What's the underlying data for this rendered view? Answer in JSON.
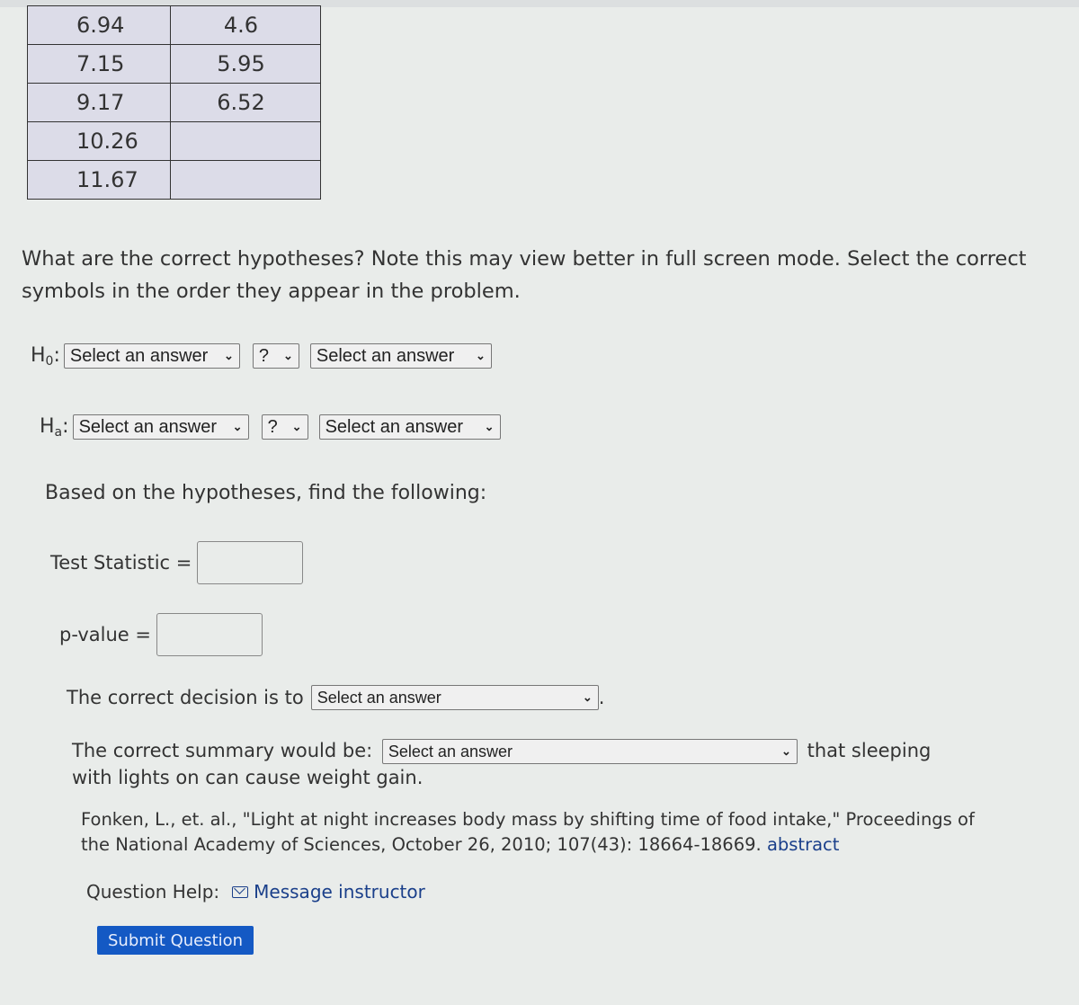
{
  "data_table": {
    "rows": [
      [
        "6.94",
        "4.6"
      ],
      [
        "7.15",
        "5.95"
      ],
      [
        "9.17",
        "6.52"
      ],
      [
        "10.26",
        ""
      ],
      [
        "11.67",
        ""
      ]
    ]
  },
  "question": {
    "text": "What are the correct hypotheses? Note this may view better in full screen mode. Select the correct symbols in the order they appear in the problem."
  },
  "hypotheses": {
    "h0": {
      "label": "H",
      "sub": "0",
      "colon": ":",
      "left": "Select an answer",
      "op": "?",
      "right": "Select an answer"
    },
    "ha": {
      "label": "H",
      "sub": "a",
      "colon": ":",
      "left": "Select an answer",
      "op": "?",
      "right": "Select an answer"
    }
  },
  "based_text": "Based on the hypotheses, find the following:",
  "fields": {
    "test_statistic_label": "Test Statistic =",
    "test_statistic_value": "",
    "p_value_label": "p-value =",
    "p_value_value": ""
  },
  "decision": {
    "prefix": "The correct decision is to",
    "select": "Select an answer",
    "suffix": "."
  },
  "summary": {
    "prefix": "The correct summary would be:",
    "select": "Select an answer",
    "suffix": "that sleeping with lights on can cause weight gain."
  },
  "citation": {
    "text": "Fonken, L., et. al., \"Light at night increases body mass by shifting time of food intake,\" Proceedings of the National Academy of Sciences, October 26, 2010; 107(43): 18664-18669.",
    "link": "abstract"
  },
  "help": {
    "label": "Question Help:",
    "link": "Message instructor"
  },
  "submit_label": "Submit Question",
  "chevron": "⌵"
}
